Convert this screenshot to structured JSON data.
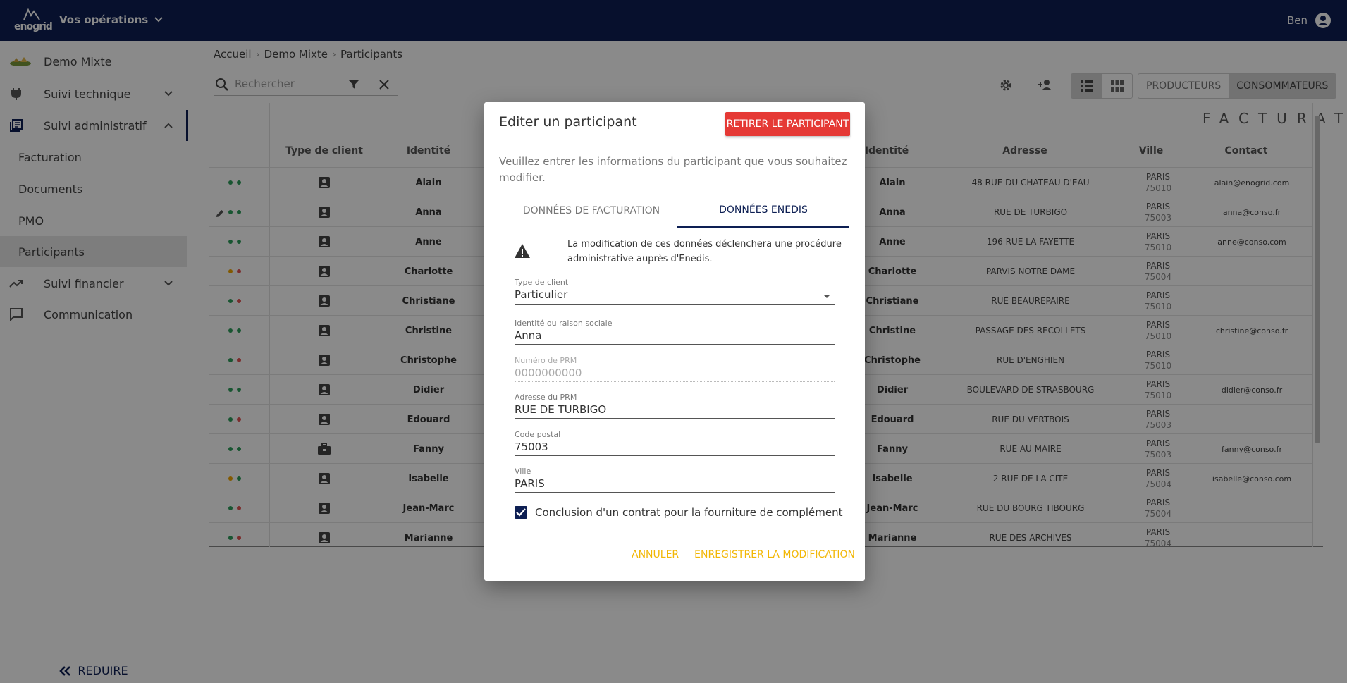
{
  "app": {
    "logo_text": "enogrid",
    "operations_label": "Vos opérations",
    "user_name": "Ben"
  },
  "sidebar": {
    "site_name": "Demo Mixte",
    "items": [
      {
        "label": "Suivi technique",
        "icon": "plug-icon"
      },
      {
        "label": "Suivi administratif",
        "icon": "list-icon"
      },
      {
        "label": "Suivi financier",
        "icon": "trending-up-icon"
      },
      {
        "label": "Communication",
        "icon": "chat-icon"
      }
    ],
    "sub_items": [
      "Facturation",
      "Documents",
      "PMO",
      "Participants"
    ],
    "active_sub": "Participants",
    "reduce_label": "REDUIRE"
  },
  "breadcrumb": [
    "Accueil",
    "Demo Mixte",
    "Participants"
  ],
  "search": {
    "placeholder": "Rechercher"
  },
  "toolbar": {
    "segments": [
      "PRODUCTEURS",
      "CONSOMMATEURS"
    ],
    "selected_segment": "CONSOMMATEURS"
  },
  "table": {
    "group_title": "FACTURATION",
    "columns": [
      "Type de client",
      "Identité",
      "Identité",
      "Adresse",
      "Ville",
      "Contact"
    ],
    "rows": [
      {
        "name": "Alain",
        "type": "person",
        "dots": [
          "#2e9e5b",
          "#2e9e5b"
        ],
        "address": "48 RUE DU CHATEAU D'EAU",
        "city": "PARIS",
        "zip": "75010",
        "contact": "alain@enogrid.com"
      },
      {
        "name": "Anna",
        "type": "person",
        "dots": [
          "#2e9e5b",
          "#2e9e5b"
        ],
        "edit": true,
        "address": "RUE DE TURBIGO",
        "city": "PARIS",
        "zip": "75003",
        "contact": "anna@conso.fr"
      },
      {
        "name": "Anne",
        "type": "person",
        "dots": [
          "#2e9e5b",
          "#2e9e5b"
        ],
        "address": "196 RUE LA FAYETTE",
        "city": "PARIS",
        "zip": "75010",
        "contact": "anne@conso.com"
      },
      {
        "name": "Charlotte",
        "type": "person",
        "dots": [
          "#f0a500",
          "#e25454"
        ],
        "address": "PARVIS NOTRE DAME",
        "city": "PARIS",
        "zip": "75004",
        "contact": ""
      },
      {
        "name": "Christiane",
        "type": "person",
        "dots": [
          "#2e9e5b",
          "#e25454"
        ],
        "address": "RUE BEAUREPAIRE",
        "city": "PARIS",
        "zip": "75010",
        "contact": ""
      },
      {
        "name": "Christine",
        "type": "person",
        "dots": [
          "#2e9e5b",
          "#2e9e5b"
        ],
        "address": "PASSAGE DES RECOLLETS",
        "city": "PARIS",
        "zip": "75010",
        "contact": "christine@conso.fr"
      },
      {
        "name": "Christophe",
        "type": "person",
        "dots": [
          "#2e9e5b",
          "#e25454"
        ],
        "address": "RUE D'ENGHIEN",
        "city": "PARIS",
        "zip": "75010",
        "contact": ""
      },
      {
        "name": "Didier",
        "type": "person",
        "dots": [
          "#2e9e5b",
          "#2e9e5b"
        ],
        "address": "BOULEVARD DE STRASBOURG",
        "city": "PARIS",
        "zip": "75010",
        "contact": "didier@conso.fr"
      },
      {
        "name": "Edouard",
        "type": "person",
        "dots": [
          "#2e9e5b",
          "#e25454"
        ],
        "address": "RUE DU VERTBOIS",
        "city": "PARIS",
        "zip": "75003",
        "contact": ""
      },
      {
        "name": "Fanny",
        "type": "business",
        "dots": [
          "#2e9e5b",
          "#2e9e5b"
        ],
        "address": "RUE AU MAIRE",
        "city": "PARIS",
        "zip": "75003",
        "contact": "fanny@conso.fr"
      },
      {
        "name": "Isabelle",
        "type": "person",
        "dots": [
          "#f0a500",
          "#2e9e5b"
        ],
        "address": "2 RUE DE LA CITE",
        "city": "PARIS",
        "zip": "75004",
        "contact": "isabelle@conso.com"
      },
      {
        "name": "Jean-Marc",
        "type": "person",
        "dots": [
          "#2e9e5b",
          "#e25454"
        ],
        "address": "RUE DU BOURG TIBOURG",
        "city": "PARIS",
        "zip": "75004",
        "contact": ""
      },
      {
        "name": "Marianne",
        "type": "person",
        "dots": [
          "#2e9e5b",
          "#e25454"
        ],
        "address": "RUE DES ARCHIVES",
        "city": "PARIS",
        "zip": "75004",
        "contact": ""
      }
    ]
  },
  "modal": {
    "title": "Editer un participant",
    "remove_label": "RETIRER LE PARTICIPANT",
    "description": "Veuillez entrer les informations du participant que vous souhaitez modifier.",
    "tabs": [
      "DONNÉES DE FACTURATION",
      "DONNÉES ENEDIS"
    ],
    "selected_tab": "DONNÉES ENEDIS",
    "warning": "La modification de ces données déclenchera une procédure administrative auprès d'Enedis.",
    "fields": {
      "client_type": {
        "label": "Type de client",
        "value": "Particulier"
      },
      "identity": {
        "label": "Identité ou raison sociale",
        "value": "Anna"
      },
      "prm": {
        "label": "Numéro de PRM",
        "value": "0000000000"
      },
      "prm_address": {
        "label": "Adresse du PRM",
        "value": "RUE DE TURBIGO"
      },
      "postal_code": {
        "label": "Code postal",
        "value": "75003"
      },
      "city": {
        "label": "Ville",
        "value": "PARIS"
      }
    },
    "checkbox_label": "Conclusion d'un contrat pour la fourniture de complément",
    "checkbox_checked": true,
    "cancel_label": "ANNULER",
    "save_label": "ENREGISTRER LA MODIFICATION"
  },
  "colors": {
    "primary": "#0d1f53",
    "danger": "#e53935",
    "accent": "#f2b705",
    "dot_green": "#2e9e5b",
    "dot_red": "#e25454",
    "dot_orange": "#f0a500"
  }
}
